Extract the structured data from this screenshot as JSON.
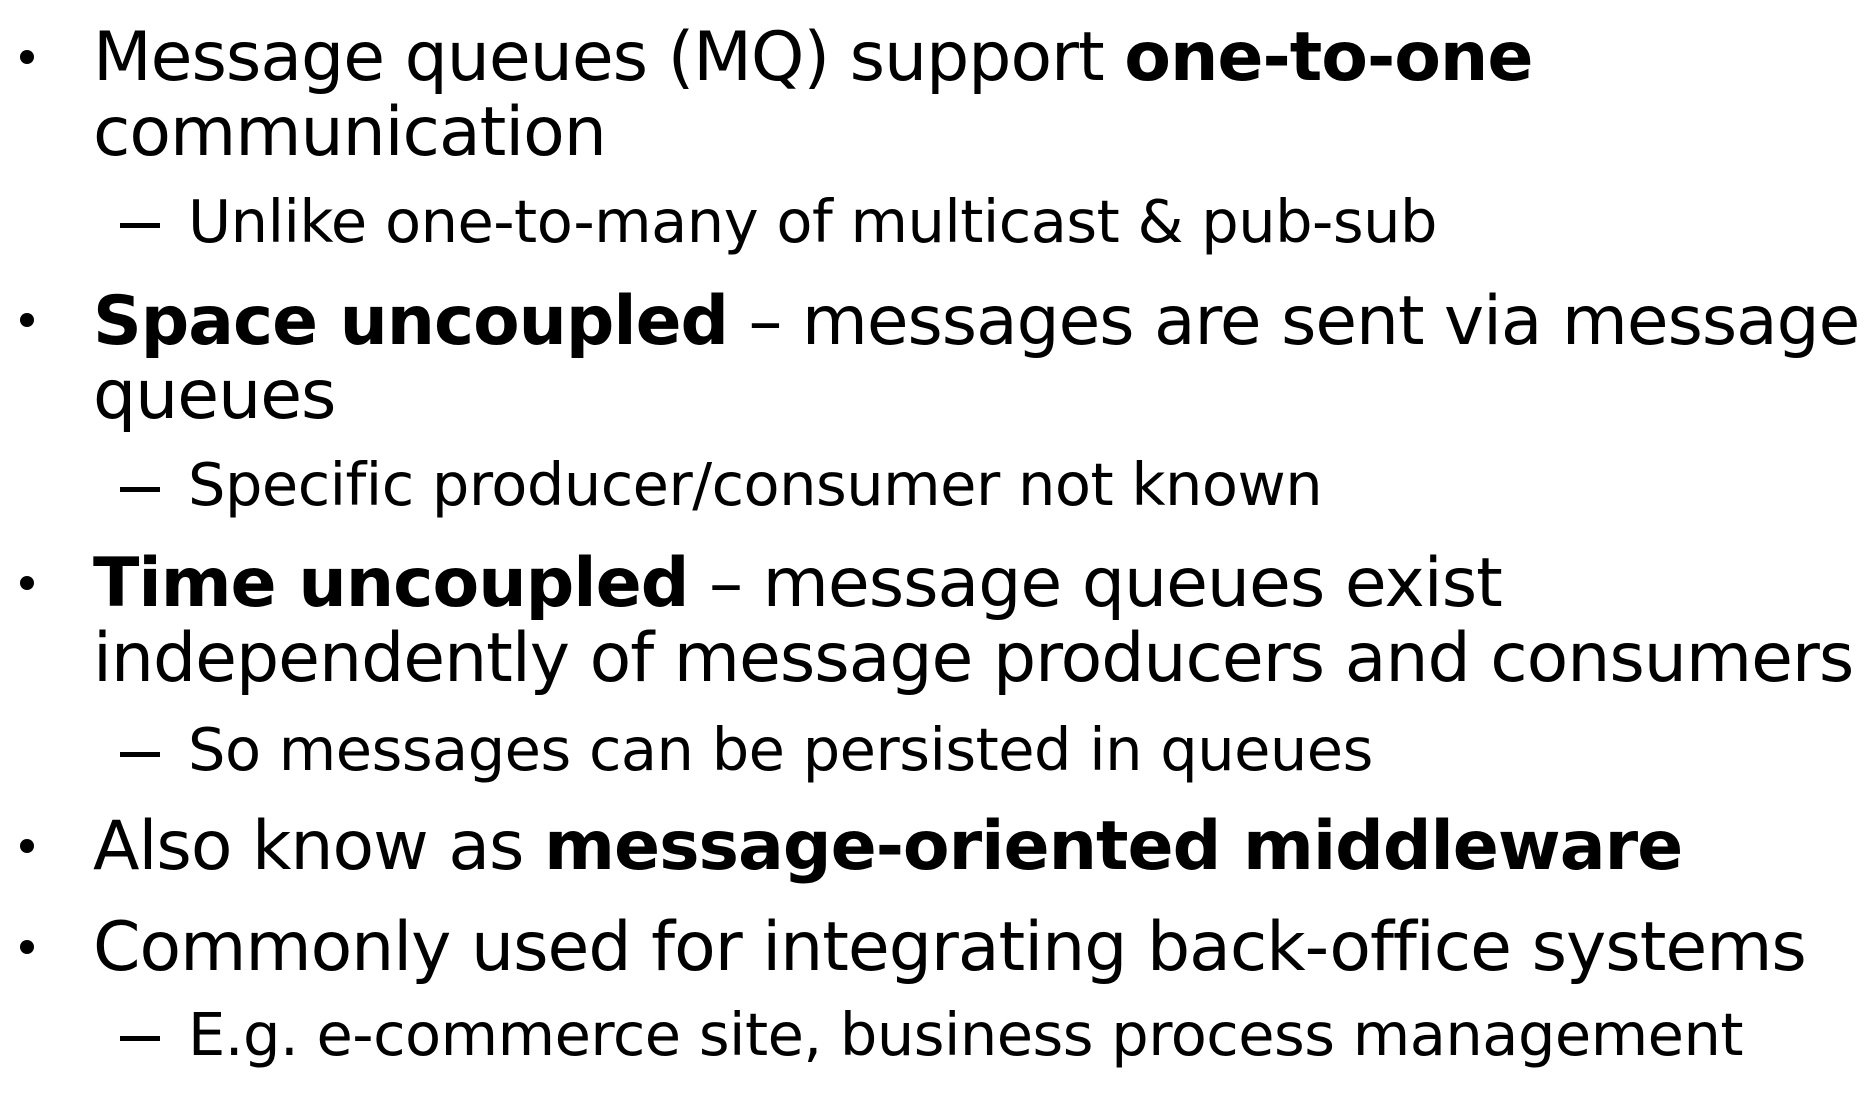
{
  "bullets": [
    {
      "lines": [
        {
          "normal1": "Message queues (MQ) support ",
          "bold1": "one-to-one",
          "normal2": ""
        },
        {
          "normal1": "communication",
          "bold1": "",
          "normal2": ""
        }
      ],
      "sub": "Unlike one-to-many of multicast & pub-sub"
    },
    {
      "lines": [
        {
          "normal1": "",
          "bold1": "Space uncoupled",
          "normal2": " – messages are sent via message"
        },
        {
          "normal1": "queues",
          "bold1": "",
          "normal2": ""
        }
      ],
      "sub": "Specific producer/consumer not known"
    },
    {
      "lines": [
        {
          "normal1": "",
          "bold1": "Time uncoupled",
          "normal2": " – message queues exist"
        },
        {
          "normal1": "independently of message producers and consumers",
          "bold1": "",
          "normal2": ""
        }
      ],
      "sub": "So messages can be persisted in queues"
    },
    {
      "lines": [
        {
          "normal1": "Also know as ",
          "bold1": "message-oriented middleware",
          "normal2": ""
        }
      ],
      "sub": ""
    },
    {
      "lines": [
        {
          "normal1": "Commonly used for integrating back-office systems",
          "bold1": "",
          "normal2": ""
        }
      ],
      "sub": "E.g. e-commerce site, business process management"
    }
  ]
}
